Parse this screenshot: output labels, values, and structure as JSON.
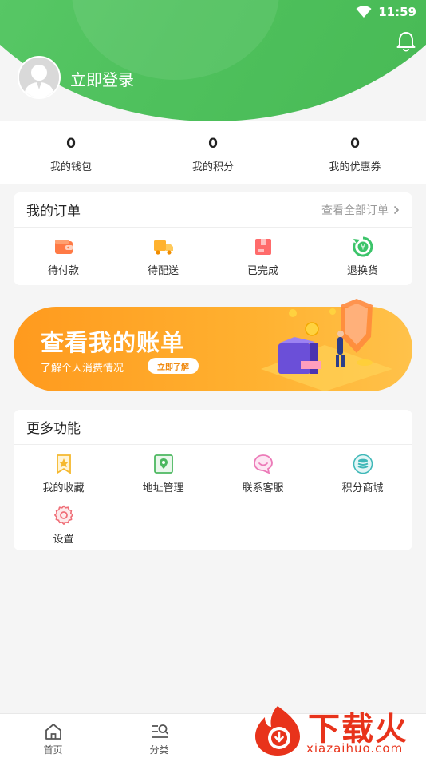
{
  "status_bar": {
    "time": "11:59"
  },
  "header": {
    "login_text": "立即登录"
  },
  "stats": [
    {
      "value": "0",
      "label": "我的钱包"
    },
    {
      "value": "0",
      "label": "我的积分"
    },
    {
      "value": "0",
      "label": "我的优惠券"
    }
  ],
  "orders": {
    "title": "我的订单",
    "view_all": "查看全部订单",
    "items": [
      {
        "label": "待付款",
        "icon": "wallet-icon"
      },
      {
        "label": "待配送",
        "icon": "truck-icon"
      },
      {
        "label": "已完成",
        "icon": "box-icon"
      },
      {
        "label": "退换货",
        "icon": "refund-icon"
      }
    ]
  },
  "banner": {
    "title": "查看我的账单",
    "subtitle": "了解个人消费情况",
    "button": "立即了解"
  },
  "more": {
    "title": "更多功能",
    "items": [
      {
        "label": "我的收藏",
        "icon": "star-bookmark-icon"
      },
      {
        "label": "地址管理",
        "icon": "location-icon"
      },
      {
        "label": "联系客服",
        "icon": "chat-icon"
      },
      {
        "label": "积分商城",
        "icon": "coins-icon"
      },
      {
        "label": "设置",
        "icon": "gear-icon"
      }
    ]
  },
  "tabbar": [
    {
      "label": "首页",
      "icon": "home-icon"
    },
    {
      "label": "分类",
      "icon": "category-search-icon"
    }
  ],
  "watermark": {
    "cn": "下载火",
    "en": "xiazaihuo.com"
  },
  "colors": {
    "brand_green": "#4fc15d",
    "accent_orange": "#ff9a1e",
    "watermark_red": "#e8331b"
  }
}
